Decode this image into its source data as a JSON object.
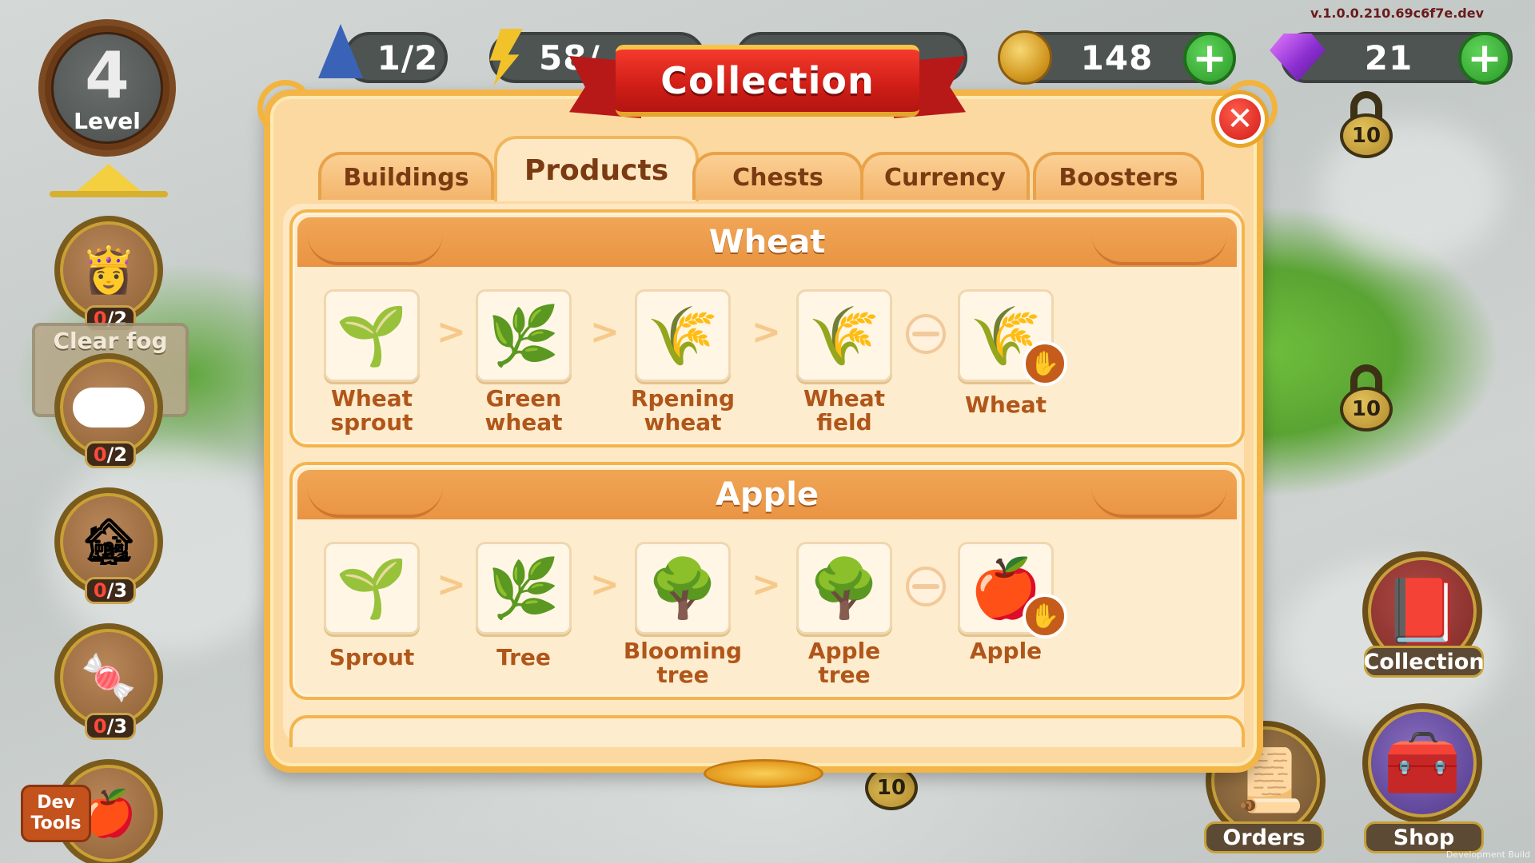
{
  "version": "v.1.0.0.210.69c6f7e.dev",
  "dev_build_label": "Development Build",
  "hud": {
    "wizard_value": "1/2",
    "energy_value": "58/",
    "coins_value": "148",
    "gems_value": "21",
    "plus_symbol": "+"
  },
  "level": {
    "number": "4",
    "label": "Level"
  },
  "left_quests": [
    {
      "count_current": "0",
      "count_total": "/2",
      "icon": "princess-icon"
    },
    {
      "count_current": "0",
      "count_total": "/2",
      "icon": "fog-cloud-icon",
      "label": "Clear fog"
    },
    {
      "count_current": "0",
      "count_total": "/3",
      "icon": "stone-building-icon"
    },
    {
      "count_current": "0",
      "count_total": "/3",
      "icon": "candy-icon"
    }
  ],
  "dev_tools": {
    "line1": "Dev",
    "line2": "Tools"
  },
  "locks": [
    "10",
    "10",
    "10"
  ],
  "right_buttons": {
    "collection": "Collection",
    "orders": "Orders",
    "shop": "Shop"
  },
  "modal": {
    "title": "Collection",
    "close_symbol": "✕",
    "tabs": [
      "Buildings",
      "Products",
      "Chests",
      "Currency",
      "Boosters"
    ],
    "active_tab": "Products",
    "sections": [
      {
        "title": "Wheat",
        "items": [
          {
            "label_line1": "Wheat",
            "label_line2": "sprout",
            "icon": "wheat-sprout-icon"
          },
          {
            "label_line1": "Green",
            "label_line2": "wheat",
            "icon": "green-wheat-icon"
          },
          {
            "label_line1": "Rpening",
            "label_line2": "wheat",
            "icon": "ripening-wheat-icon"
          },
          {
            "label_line1": "Wheat",
            "label_line2": "field",
            "icon": "wheat-field-icon"
          },
          {
            "label_line1": "Wheat",
            "label_line2": "",
            "icon": "wheat-sheaf-icon"
          }
        ]
      },
      {
        "title": "Apple",
        "items": [
          {
            "label_line1": "Sprout",
            "label_line2": "",
            "icon": "sprout-icon"
          },
          {
            "label_line1": "Tree",
            "label_line2": "",
            "icon": "tree-icon"
          },
          {
            "label_line1": "Blooming",
            "label_line2": "tree",
            "icon": "blooming-tree-icon"
          },
          {
            "label_line1": "Apple",
            "label_line2": "tree",
            "icon": "apple-tree-icon"
          },
          {
            "label_line1": "Apple",
            "label_line2": "",
            "icon": "apple-icon"
          }
        ]
      }
    ],
    "separator_symbol": ">"
  }
}
